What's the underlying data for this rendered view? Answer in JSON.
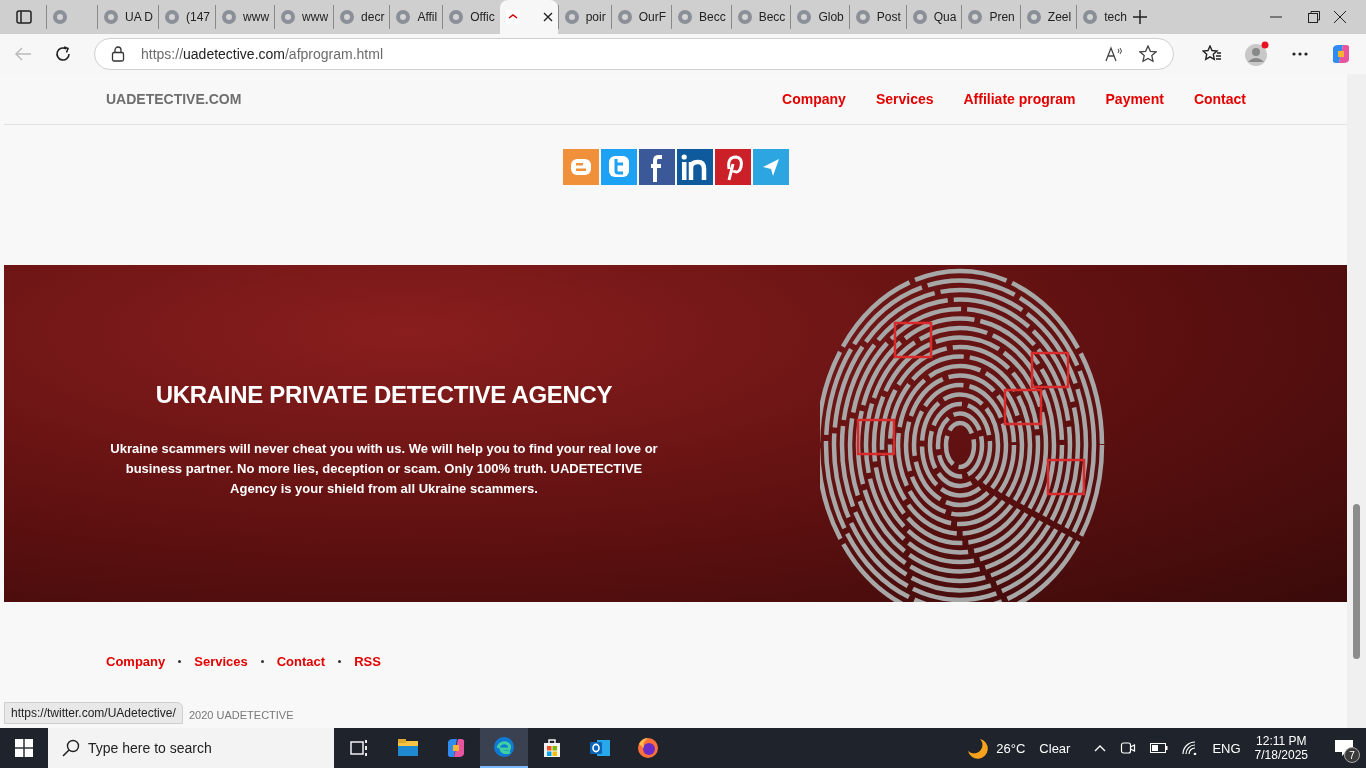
{
  "browser": {
    "tabs": [
      {
        "selected": false
      },
      {
        "title": "UA D",
        "selected": false
      },
      {
        "title": "(147",
        "selected": false
      },
      {
        "title": "www",
        "selected": false
      },
      {
        "title": "www",
        "selected": false
      },
      {
        "title": "decr",
        "selected": false
      },
      {
        "title": "Affil",
        "selected": false
      },
      {
        "title": "Offic",
        "selected": false
      },
      {
        "selected": true
      },
      {
        "title": "poir",
        "selected": false
      },
      {
        "title": "OurF",
        "selected": false
      },
      {
        "title": "Becc",
        "selected": false
      },
      {
        "title": "Becc",
        "selected": false
      },
      {
        "title": "Glob",
        "selected": false
      },
      {
        "title": "Post",
        "selected": false
      },
      {
        "title": "Qua",
        "selected": false
      },
      {
        "title": "Pren",
        "selected": false
      },
      {
        "title": "Zeel",
        "selected": false
      },
      {
        "title": "tech",
        "selected": false
      }
    ],
    "address": {
      "scheme": "https://",
      "host": "uadetective.com",
      "path": "/afprogram.html"
    }
  },
  "site": {
    "logo": "UADETECTIVE.COM",
    "nav": [
      "Company",
      "Services",
      "Affiliate program",
      "Payment",
      "Contact"
    ],
    "social": [
      {
        "kind": "blogger"
      },
      {
        "kind": "twitter"
      },
      {
        "kind": "facebook"
      },
      {
        "kind": "linkedin"
      },
      {
        "kind": "pinterest"
      },
      {
        "kind": "telegram"
      }
    ],
    "banner": {
      "title": "UKRAINE PRIVATE DETECTIVE AGENCY",
      "text": "Ukraine scammers will never cheat you with us. We will help you to find your real love or business partner. No more lies, deception or scam. Only 100% truth. UADETECTIVE Agency is your shield from all Ukraine scammers."
    },
    "footer_links": [
      "Company",
      "Services",
      "Contact",
      "RSS"
    ],
    "copyright": "2020 UADETECTIVE"
  },
  "status_tooltip": "https://twitter.com/UAdetective/",
  "taskbar": {
    "search_placeholder": "Type here to search",
    "apps": [
      {
        "kind": "explorer",
        "selected": false
      },
      {
        "kind": "copilot",
        "selected": false
      },
      {
        "kind": "edge",
        "selected": true
      },
      {
        "kind": "store",
        "selected": false
      },
      {
        "kind": "outlook",
        "selected": false
      },
      {
        "kind": "firefox",
        "selected": false
      }
    ],
    "temperature": "26°C",
    "weather": "Clear",
    "language": "ENG",
    "time": "12:11 PM",
    "date": "7/18/2025",
    "notifications": "7"
  }
}
